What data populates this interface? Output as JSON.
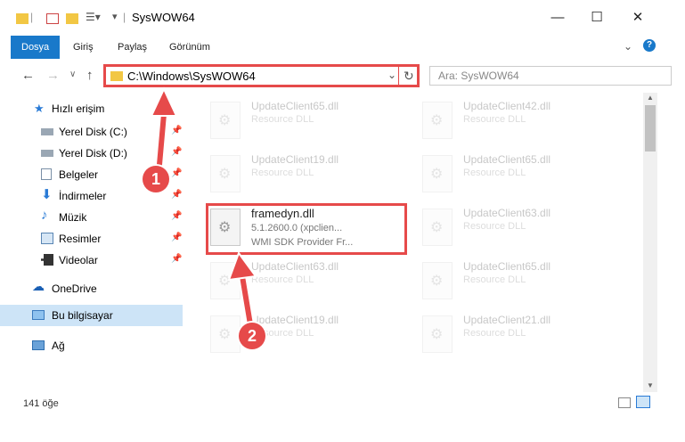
{
  "window": {
    "title": "SysWOW64"
  },
  "ribbon": {
    "tabs": [
      "Dosya",
      "Giriş",
      "Paylaş",
      "Görünüm"
    ]
  },
  "address": {
    "path": "C:\\Windows\\SysWOW64"
  },
  "search": {
    "placeholder": "Ara: SysWOW64"
  },
  "sidebar": {
    "quick_access": "Hızlı erişim",
    "items": [
      {
        "label": "Yerel Disk (C:)"
      },
      {
        "label": "Yerel Disk (D:)"
      },
      {
        "label": "Belgeler"
      },
      {
        "label": "İndirmeler"
      },
      {
        "label": "Müzik"
      },
      {
        "label": "Resimler"
      },
      {
        "label": "Videolar"
      }
    ],
    "onedrive": "OneDrive",
    "this_pc": "Bu bilgisayar",
    "network": "Ağ"
  },
  "files": {
    "left": [
      {
        "name": "UpdateClient65.dll",
        "type": "Resource DLL"
      },
      {
        "name": "UpdateClient19.dll",
        "type": "Resource DLL"
      },
      {
        "name": "framedyn.dll",
        "version": "5.1.2600.0 (xpclien...",
        "desc": "WMI SDK Provider Fr..."
      },
      {
        "name": "UpdateClient63.dll",
        "type": "Resource DLL"
      },
      {
        "name": "UpdateClient19.dll",
        "type": "Resource DLL"
      }
    ],
    "right": [
      {
        "name": "UpdateClient42.dll",
        "type": "Resource DLL"
      },
      {
        "name": "UpdateClient65.dll",
        "type": "Resource DLL"
      },
      {
        "name": "UpdateClient63.dll",
        "type": "Resource DLL"
      },
      {
        "name": "UpdateClient65.dll",
        "type": "Resource DLL"
      },
      {
        "name": "UpdateClient21.dll",
        "type": "Resource DLL"
      }
    ]
  },
  "status": {
    "count": "141 öğe"
  },
  "annotations": {
    "step1": "1",
    "step2": "2"
  },
  "colors": {
    "accent": "#1979ca",
    "highlight": "#e64a4a"
  }
}
